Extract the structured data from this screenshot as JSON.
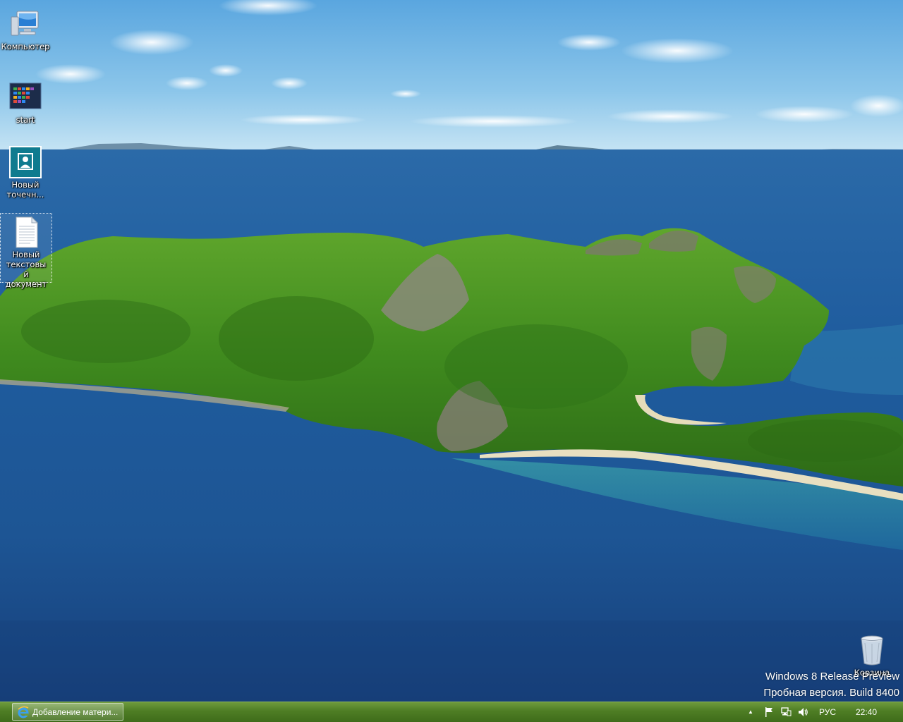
{
  "desktop": {
    "icons": [
      {
        "label": "Компьютер"
      },
      {
        "label": "start"
      },
      {
        "label": "Новый точечн..."
      },
      {
        "label": "Новый текстовый документ"
      },
      {
        "label": "Корзина"
      }
    ]
  },
  "watermark": {
    "line1": "Windows 8 Release Preview",
    "line2": "Пробная версия. Build 8400"
  },
  "taskbar": {
    "active_task": {
      "label": "Добавление матери...",
      "icon": "internet-explorer-icon"
    },
    "tray": {
      "show_hidden": "▲",
      "language": "РУС",
      "clock": "22:40"
    },
    "color": "#4e7d24"
  },
  "colors": {
    "taskbar": "#4e7d24",
    "sea": "#1f5ea0",
    "sky": "#6fb2e0"
  }
}
